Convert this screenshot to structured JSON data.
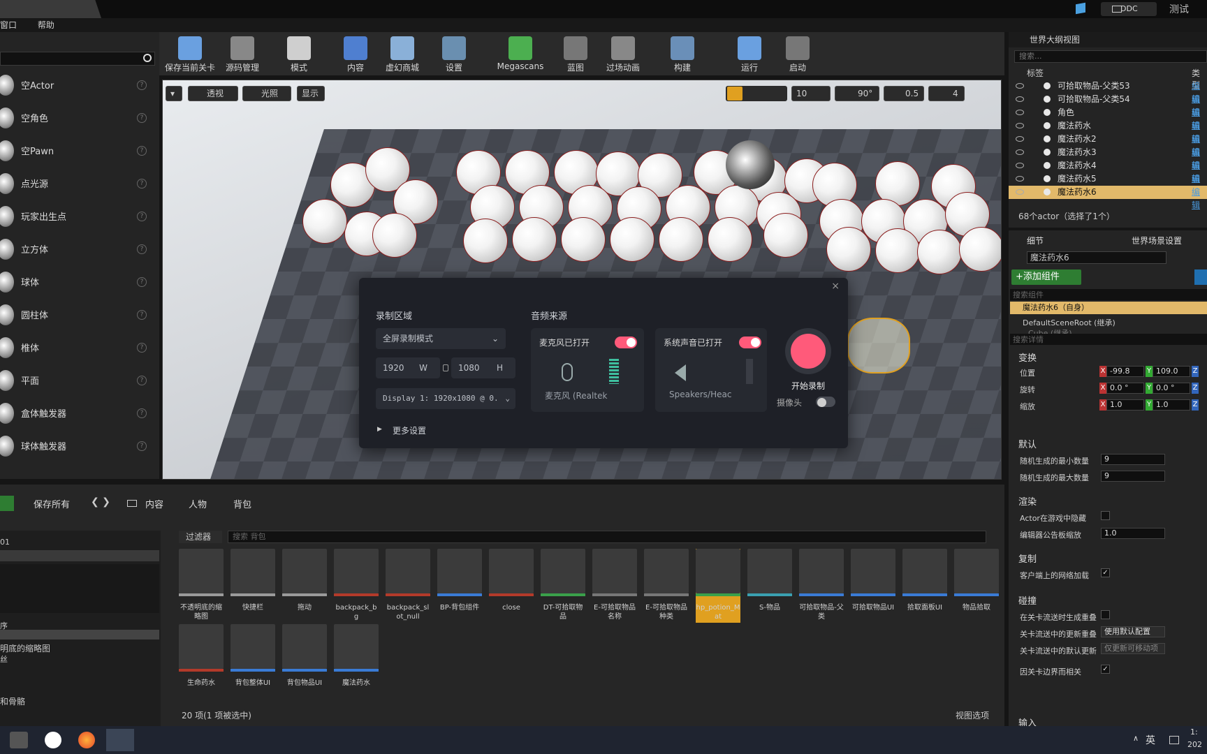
{
  "titlebar": {
    "right_badge": "DDC",
    "right_label": "测试"
  },
  "menu": [
    "窗口",
    "帮助"
  ],
  "place_panel": {
    "items": [
      "空Actor",
      "空角色",
      "空Pawn",
      "点光源",
      "玩家出生点",
      "立方体",
      "球体",
      "圆柱体",
      "椎体",
      "平面",
      "盒体触发器",
      "球体触发器"
    ]
  },
  "toolbar": {
    "buttons": [
      "保存当前关卡",
      "源码管理",
      "模式",
      "内容",
      "虚幻商城",
      "设置",
      "Megascans",
      "蓝图",
      "过场动画",
      "构建",
      "运行",
      "启动"
    ]
  },
  "viewport": {
    "perspective": "透视",
    "lit": "光照",
    "show": "显示",
    "grid_snap": "10",
    "rot_snap": "90°",
    "scale_snap": "0.5",
    "camera_speed": "4"
  },
  "recorder": {
    "area_title": "录制区域",
    "mode": "全屏录制模式",
    "width": "1920",
    "w_label": "W",
    "height": "1080",
    "h_label": "H",
    "display": "Display 1: 1920x1080 @ 0.",
    "more": "更多设置",
    "audio_title": "音频来源",
    "mic_title": "麦克风已打开",
    "mic_device": "麦克风 (Realtek",
    "sys_title": "系统声音已打开",
    "sys_device": "Speakers/Heac",
    "start": "开始录制",
    "camera": "摄像头",
    "close": "×"
  },
  "outliner": {
    "tab": "世界大纲视图",
    "search_placeholder": "搜索...",
    "col_label": "标签",
    "col_type": "类型",
    "rows": [
      {
        "name": "可拾取物品-父类53",
        "edit": "编辑"
      },
      {
        "name": "可拾取物品-父类54",
        "edit": "编辑"
      },
      {
        "name": "角色",
        "edit": "编辑"
      },
      {
        "name": "魔法药水",
        "edit": "编辑"
      },
      {
        "name": "魔法药水2",
        "edit": "编辑"
      },
      {
        "name": "魔法药水3",
        "edit": "编辑"
      },
      {
        "name": "魔法药水4",
        "edit": "编辑"
      },
      {
        "name": "魔法药水5",
        "edit": "编辑"
      },
      {
        "name": "魔法药水6",
        "edit": "编辑"
      }
    ],
    "count": "68个actor（选择了1个）"
  },
  "details": {
    "tab_details": "细节",
    "tab_world": "世界场景设置",
    "name": "魔法药水6",
    "add_component": "+添加组件",
    "search_components": "搜索组件",
    "self_item": "魔法药水6（自身）",
    "root_item": "DefaultSceneRoot (继承)",
    "child_item": "Cube (继承)",
    "search_details": "搜索详情",
    "transform": "变换",
    "location": "位置",
    "rotation": "旋转",
    "scale": "缩放",
    "loc_x": "-99.8",
    "loc_y": "109.0",
    "rot_x": "0.0 °",
    "rot_y": "0.0 °",
    "scl_x": "1.0",
    "scl_y": "1.0",
    "default": "默认",
    "rand_min_label": "随机生成的最小数量",
    "rand_min": "9",
    "rand_max_label": "随机生成的最大数量",
    "rand_max": "9",
    "render": "渲染",
    "hidden_in_game": "Actor在游戏中隐藏",
    "billboard_scale": "编辑器公告板缩放",
    "billboard_val": "1.0",
    "replication": "复制",
    "net_load": "客户端上的网络加载",
    "collision": "碰撞",
    "gen_overlap": "在关卡流送时生成重叠",
    "update_overlap": "关卡流送中的更新重叠",
    "update_overlap_val": "使用默认配置",
    "default_update": "关卡流送中的默认更新",
    "default_update_val": "仅更新可移动项",
    "bounds": "因关卡边界而相关",
    "input": "输入"
  },
  "content_browser": {
    "save_all": "保存所有",
    "path": [
      "内容",
      "人物",
      "背包"
    ],
    "filter": "过滤器",
    "search_placeholder": "搜索 背包",
    "tree": [
      "01",
      "序",
      "明底的缩略图",
      "丝",
      "和骨骼"
    ],
    "assets_row1": [
      {
        "name": "不透明底的缩略图",
        "color": "#9a9a9a"
      },
      {
        "name": "快捷栏",
        "color": "#9a9a9a"
      },
      {
        "name": "拖动",
        "color": "#9a9a9a"
      },
      {
        "name": "backpack_bg",
        "color": "#b33a2a"
      },
      {
        "name": "backpack_slot_null",
        "color": "#b33a2a"
      },
      {
        "name": "BP-背包组件",
        "color": "#3a7bd5"
      },
      {
        "name": "close",
        "color": "#b33a2a"
      },
      {
        "name": "DT-可拾取物品",
        "color": "#3aa04a"
      },
      {
        "name": "E-可拾取物品名称",
        "color": "#777"
      },
      {
        "name": "E-可拾取物品种类",
        "color": "#777"
      },
      {
        "name": "hp_potion_Mat",
        "color": "#3aa04a"
      },
      {
        "name": "S-物品",
        "color": "#3aa0b0"
      },
      {
        "name": "可拾取物品-父类",
        "color": "#3a7bd5"
      },
      {
        "name": "可拾取物品UI",
        "color": "#3a7bd5"
      },
      {
        "name": "拾取面板UI",
        "color": "#3a7bd5"
      },
      {
        "name": "物品拾取",
        "color": "#3a7bd5"
      }
    ],
    "assets_row2": [
      {
        "name": "生命药水",
        "color": "#b33a2a"
      },
      {
        "name": "背包整体UI",
        "color": "#3a7bd5"
      },
      {
        "name": "背包物品UI",
        "color": "#3a7bd5"
      },
      {
        "name": "魔法药水",
        "color": "#3a7bd5"
      }
    ],
    "status": "20 项(1 项被选中)",
    "view_options": "视图选项"
  },
  "taskbar": {
    "ime": "英",
    "time": "1:",
    "year": "202"
  }
}
